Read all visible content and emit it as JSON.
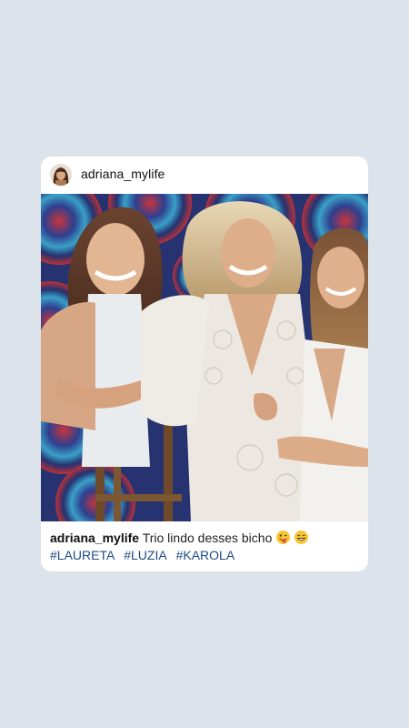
{
  "post": {
    "username": "adriana_mylife",
    "caption_user": "adriana_mylife",
    "caption_text": "Trio lindo desses bicho",
    "caption_emojis": [
      "tongue-wink-emoji",
      "grinning-emoji"
    ],
    "hashtags": [
      "#LAURETA",
      "#LUZIA",
      "#KAROLA"
    ]
  },
  "colors": {
    "background": "#dde3ea",
    "card": "#ffffff",
    "hashtag": "#1d4a86"
  }
}
